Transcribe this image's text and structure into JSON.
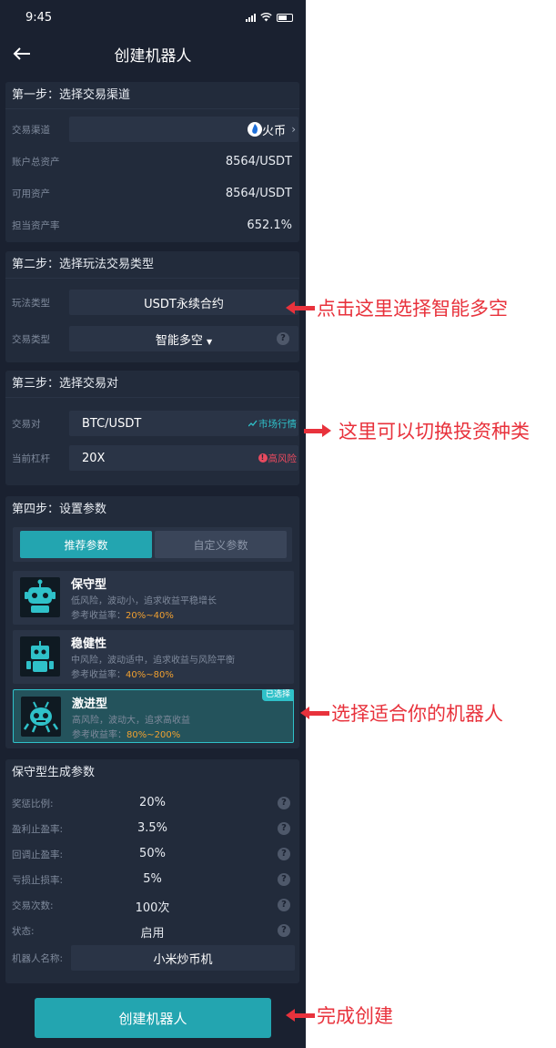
{
  "status": {
    "time": "9:45"
  },
  "nav": {
    "title": "创建机器人"
  },
  "step1": {
    "title": "第一步：选择交易渠道",
    "channel_label": "交易渠道",
    "channel_value": "火币",
    "total_assets_label": "账户总资产",
    "total_assets_value": "8564/USDT",
    "available_label": "可用资产",
    "available_value": "8564/USDT",
    "collateral_label": "担当资产率",
    "collateral_value": "652.1%"
  },
  "step2": {
    "title": "第二步：选择玩法交易类型",
    "play_type_label": "玩法类型",
    "play_type_value": "USDT永续合约",
    "trade_type_label": "交易类型",
    "trade_type_value": "智能多空"
  },
  "step3": {
    "title": "第三步：选择交易对",
    "pair_label": "交易对",
    "pair_value": "BTC/USDT",
    "market_link": "市场行情",
    "leverage_label": "当前杠杆",
    "leverage_value": "20X",
    "risk_label": "高风险"
  },
  "step4": {
    "title": "第四步：设置参数",
    "tab_recommended": "推荐参数",
    "tab_custom": "自定义参数",
    "bots": [
      {
        "name": "保守型",
        "desc": "低风险，波动小，追求收益平稳增长",
        "yield_label": "参考收益率：",
        "yield_range": "20%~40%"
      },
      {
        "name": "稳健性",
        "desc": "中风险，波动适中，追求收益与风险平衡",
        "yield_label": "参考收益率：",
        "yield_range": "40%~80%"
      },
      {
        "name": "激进型",
        "desc": "高风险，波动大，追求高收益",
        "yield_label": "参考收益率：",
        "yield_range": "80%~200%",
        "badge": "已选择"
      }
    ]
  },
  "params": {
    "title": "保守型生成参数",
    "rows": [
      {
        "label": "奖惩比例:",
        "value": "20%"
      },
      {
        "label": "盈利止盈率:",
        "value": "3.5%"
      },
      {
        "label": "回调止盈率:",
        "value": "50%"
      },
      {
        "label": "亏损止损率:",
        "value": "5%"
      },
      {
        "label": "交易次数:",
        "value": "100次"
      },
      {
        "label": "状态:",
        "value": "启用"
      }
    ],
    "name_label": "机器人名称:",
    "name_value": "小米炒币机"
  },
  "create_button": "创建机器人",
  "annotations": {
    "a1": "点击这里选择智能多空",
    "a2": "这里可以切换投资种类",
    "a3": "选择适合你的机器人",
    "a4": "完成创建"
  },
  "colors": {
    "accent": "#23a5b0",
    "background": "#1a2130",
    "card": "#222b3b",
    "yield": "#f0a030",
    "annotation": "#e8323c",
    "risk": "#e84a5f"
  }
}
